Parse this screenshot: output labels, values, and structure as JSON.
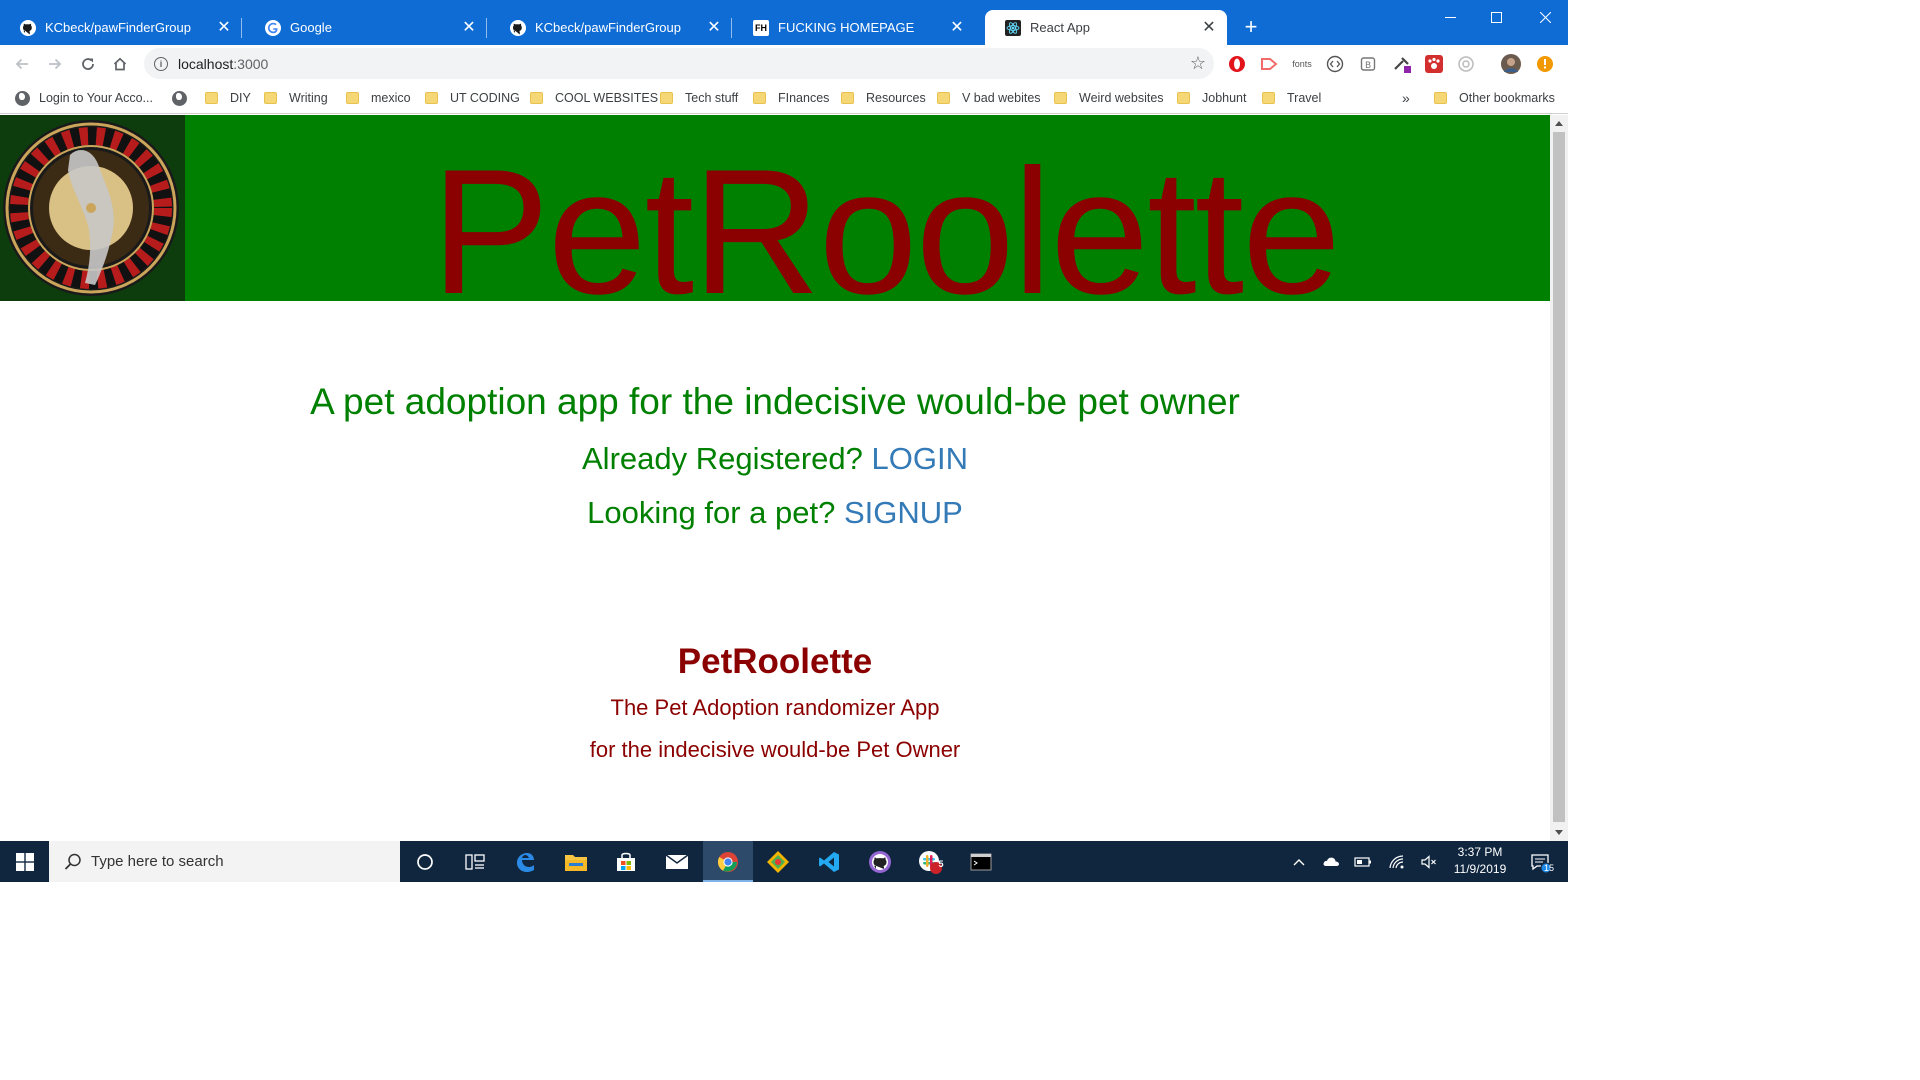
{
  "browser": {
    "tabs": [
      {
        "title": "KCbeck/pawFinderGroup",
        "icon": "github-icon",
        "active": false
      },
      {
        "title": "Google",
        "icon": "google-icon",
        "active": false
      },
      {
        "title": "KCbeck/pawFinderGroup",
        "icon": "github-icon",
        "active": false
      },
      {
        "title": "FUCKING HOMEPAGE",
        "icon": "fh-icon",
        "icon_text": "FH",
        "active": false
      },
      {
        "title": "React App",
        "icon": "react-icon",
        "active": true
      }
    ],
    "url_host": "localhost",
    "url_port": ":3000",
    "extensions_fonts_label": "fonts",
    "bookmarks": [
      {
        "label": "Login to Your Acco...",
        "icon": "globe-icon"
      },
      {
        "label": "",
        "icon": "globe-icon"
      },
      {
        "label": "DIY",
        "icon": "folder-icon"
      },
      {
        "label": "Writing",
        "icon": "folder-icon"
      },
      {
        "label": "mexico",
        "icon": "folder-icon"
      },
      {
        "label": "UT CODING",
        "icon": "folder-icon"
      },
      {
        "label": "COOL WEBSITES",
        "icon": "folder-icon"
      },
      {
        "label": "Tech stuff",
        "icon": "folder-icon"
      },
      {
        "label": "FInances",
        "icon": "folder-icon"
      },
      {
        "label": "Resources",
        "icon": "folder-icon"
      },
      {
        "label": "V bad webites",
        "icon": "folder-icon"
      },
      {
        "label": "Weird websites",
        "icon": "folder-icon"
      },
      {
        "label": "Jobhunt",
        "icon": "folder-icon"
      },
      {
        "label": "Travel",
        "icon": "folder-icon"
      }
    ],
    "bookmarks_overflow": "»",
    "other_bookmarks": "Other bookmarks"
  },
  "page": {
    "banner_title": "PetRoolette",
    "tagline": "A pet adoption app for the indecisive would-be pet owner",
    "login_prompt": "Already Registered?",
    "login_link": "LOGIN",
    "signup_prompt": "Looking for a pet?",
    "signup_link": "SIGNUP",
    "footer_title": "PetRoolette",
    "footer_line1": "The Pet Adoption randomizer App",
    "footer_line2": "for the indecisive would-be Pet Owner",
    "colors": {
      "banner_bg": "#008000",
      "title_red": "#8b0000",
      "text_green": "#008000",
      "link_blue": "#337ab7"
    }
  },
  "taskbar": {
    "search_placeholder": "Type here to search",
    "time": "3:37 PM",
    "date": "11/9/2019",
    "slack_badge": "5",
    "notification_count": "15"
  }
}
